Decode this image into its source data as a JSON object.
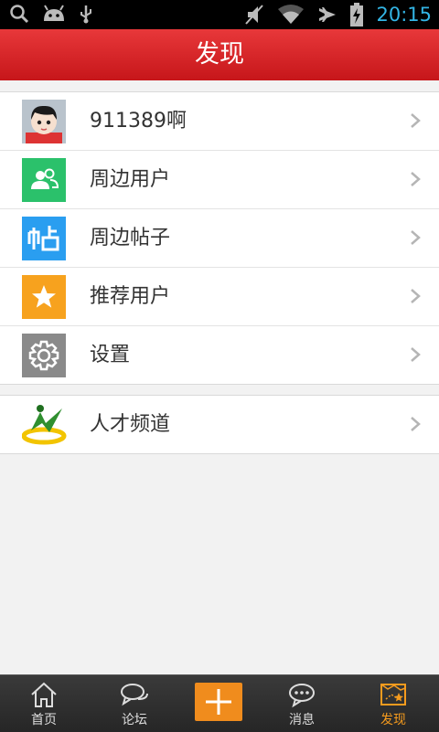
{
  "status_bar": {
    "time": "20:15",
    "icons": [
      "search-icon",
      "android-icon",
      "usb-icon",
      "mute-icon",
      "wifi-icon",
      "airplane-icon",
      "battery-charging-icon"
    ]
  },
  "header": {
    "title": "发现"
  },
  "profile": {
    "name": "911389啊"
  },
  "menu": [
    {
      "label": "周边用户",
      "icon": "nearby-users-icon",
      "color": "#2bc16b"
    },
    {
      "label": "周边帖子",
      "icon": "nearby-posts-icon",
      "color": "#2a9ef0"
    },
    {
      "label": "推荐用户",
      "icon": "star-icon",
      "color": "#f7a21e"
    },
    {
      "label": "设置",
      "icon": "gear-icon",
      "color": "#8a8a8a"
    }
  ],
  "talent": {
    "label": "人才频道",
    "icon": "talent-logo"
  },
  "tabs": [
    {
      "label": "首页",
      "icon": "home-icon"
    },
    {
      "label": "论坛",
      "icon": "forum-icon"
    },
    {
      "label": "",
      "icon": "plus-icon"
    },
    {
      "label": "消息",
      "icon": "message-icon"
    },
    {
      "label": "发现",
      "icon": "discover-icon",
      "active": true
    }
  ],
  "colors": {
    "header_red": "#d9262a",
    "accent_orange": "#f59b1e",
    "clock_blue": "#33b5e5"
  }
}
